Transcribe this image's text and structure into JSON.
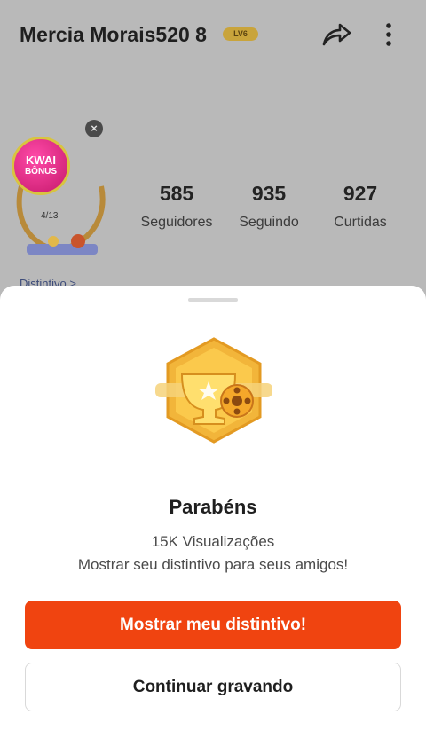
{
  "profile": {
    "username": "Mercia Morais520 8",
    "level": "LV6",
    "stats": [
      {
        "value": "585",
        "label": "Seguidores"
      },
      {
        "value": "935",
        "label": "Seguindo"
      },
      {
        "value": "927",
        "label": "Curtidas"
      }
    ],
    "bonus": {
      "title": "KWAI",
      "subtitle": "BÔNUS",
      "progress": "4/13",
      "close_icon": "close-icon"
    },
    "distintivo_link": "Distintivo >"
  },
  "sheet": {
    "title": "Parabéns",
    "subtitle": "15K Visualizações",
    "description": "Mostrar seu distintivo para seus amigos!",
    "primary_button": "Mostrar meu distintivo!",
    "secondary_button": "Continuar gravando"
  },
  "colors": {
    "accent": "#f04410",
    "badge_gold": "#f5b72a",
    "overlay": "#b9b9b9"
  }
}
